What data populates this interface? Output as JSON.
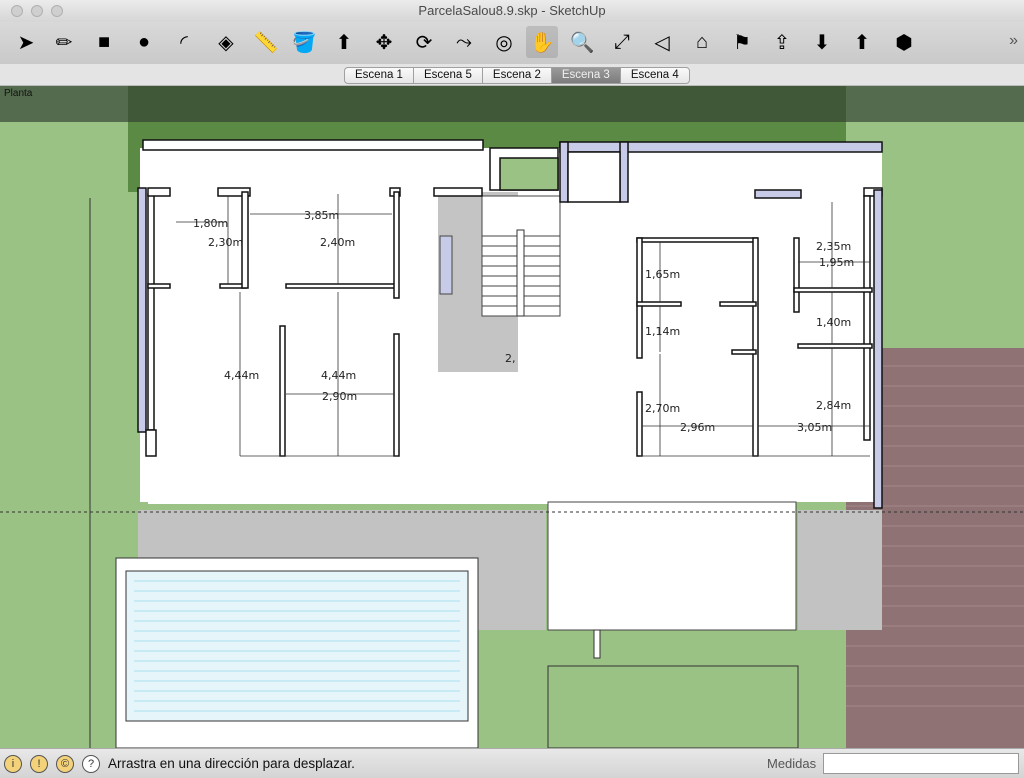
{
  "window": {
    "title": "ParcelaSalou8.9.skp - SketchUp"
  },
  "toolbar": {
    "tools": [
      {
        "name": "select-tool-icon",
        "glyph": "➤"
      },
      {
        "name": "pencil-tool-icon",
        "glyph": "✏"
      },
      {
        "name": "rectangle-tool-icon",
        "glyph": "■"
      },
      {
        "name": "circle-tool-icon",
        "glyph": "●"
      },
      {
        "name": "arc-tool-icon",
        "glyph": "◜"
      },
      {
        "name": "eraser-tool-icon",
        "glyph": "◈"
      },
      {
        "name": "tape-measure-icon",
        "glyph": "📏"
      },
      {
        "name": "paint-bucket-icon",
        "glyph": "🪣"
      },
      {
        "name": "push-pull-icon",
        "glyph": "⬆"
      },
      {
        "name": "move-tool-icon",
        "glyph": "✥"
      },
      {
        "name": "rotate-tool-icon",
        "glyph": "⟳"
      },
      {
        "name": "follow-me-icon",
        "glyph": "⤳"
      },
      {
        "name": "orbit-tool-icon",
        "glyph": "◎"
      },
      {
        "name": "pan-tool-icon",
        "glyph": "✋"
      },
      {
        "name": "zoom-tool-icon",
        "glyph": "🔍"
      },
      {
        "name": "zoom-extents-icon",
        "glyph": "⤢"
      },
      {
        "name": "previous-view-icon",
        "glyph": "◁"
      },
      {
        "name": "warehouse-icon",
        "glyph": "⌂"
      },
      {
        "name": "add-location-icon",
        "glyph": "⚑"
      },
      {
        "name": "share-model-icon",
        "glyph": "⇪"
      },
      {
        "name": "get-models-icon",
        "glyph": "⬇"
      },
      {
        "name": "share-component-icon",
        "glyph": "⬆"
      },
      {
        "name": "extension-warehouse-icon",
        "glyph": "⬢"
      }
    ],
    "overflow": "»"
  },
  "scenes": {
    "tabs": [
      "Escena 1",
      "Escena 5",
      "Escena 2",
      "Escena 3",
      "Escena 4"
    ],
    "selected": "Escena 3"
  },
  "viewport": {
    "scene_label": "Planta",
    "dimensions": [
      "1,80m",
      "3,85m",
      "2,30m",
      "2,40m",
      "4,44m",
      "4,44m",
      "2,90m",
      "2,35m",
      "1,95m",
      "1,65m",
      "1,14m",
      "1,40m",
      "2,70m",
      "2,96m",
      "2,84m",
      "3,05m",
      "2,"
    ]
  },
  "status": {
    "message": "Arrastra en una dirección para desplazar.",
    "measure_label": "Medidas",
    "measure_value": "",
    "icons": [
      "geolocation-icon",
      "credits-icon",
      "license-icon",
      "help-icon"
    ]
  },
  "colors": {
    "grass": "#9bc285",
    "dark_grass": "#5c8a44",
    "paving": "#c0c0c0",
    "brick": "#8f7273",
    "wall_face": "#c7cbe8",
    "water": "#e0f0f8"
  }
}
